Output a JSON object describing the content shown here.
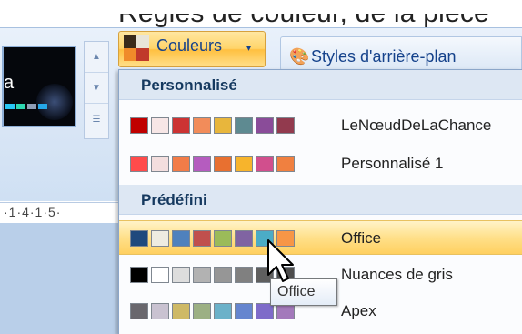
{
  "top_fragment": {
    "text": "Régles de couleur, de la pièce"
  },
  "ribbon": {
    "colors_button": {
      "label": "Couleurs",
      "caret": "▾"
    },
    "background_styles_button": {
      "label": "Styles d'arrière-plan"
    },
    "ruler_text": "·1·4·1·5·",
    "thumbnail_text": "a",
    "thumbnail_bar_colors": [
      "#27c7f5",
      "#2dd7b1",
      "#8e9db6",
      "#25a7e8"
    ],
    "scroll": {
      "up": "▲",
      "down": "▼",
      "more": "☰"
    }
  },
  "dropdown": {
    "sections": [
      {
        "title": "Personnalisé",
        "rows": [
          {
            "label": "LeNœudDeLaChance",
            "colors": [
              "#c00000",
              "#f7e6e6",
              "#cc3333",
              "#f28c5a",
              "#e8b63c",
              "#5e8a91",
              "#8a4c99",
              "#923a4e"
            ]
          },
          {
            "label": "Personnalisé 1",
            "colors": [
              "#ff4b4b",
              "#f3dede",
              "#f27c48",
              "#b55cbf",
              "#e87030",
              "#f7b42c",
              "#d14f8d",
              "#f08040"
            ]
          }
        ]
      },
      {
        "title": "Prédéfini",
        "rows": [
          {
            "label": "Office",
            "colors": [
              "#1f497d",
              "#eeece1",
              "#4f81bd",
              "#c0504d",
              "#9bbb59",
              "#8064a2",
              "#4bacc6",
              "#f79646"
            ],
            "highlighted": true
          },
          {
            "label": "Nuances de gris",
            "colors": [
              "#000000",
              "#ffffff",
              "#dddddd",
              "#b2b2b2",
              "#969696",
              "#808080",
              "#5f5f5f",
              "#4d4d4d"
            ]
          },
          {
            "label": "Apex",
            "colors": [
              "#69676d",
              "#c9c2d1",
              "#ceb966",
              "#9cb084",
              "#6bb1c9",
              "#6585cf",
              "#7e6bc9",
              "#a379bb"
            ]
          }
        ]
      }
    ]
  },
  "tooltip": {
    "text": "Office"
  }
}
